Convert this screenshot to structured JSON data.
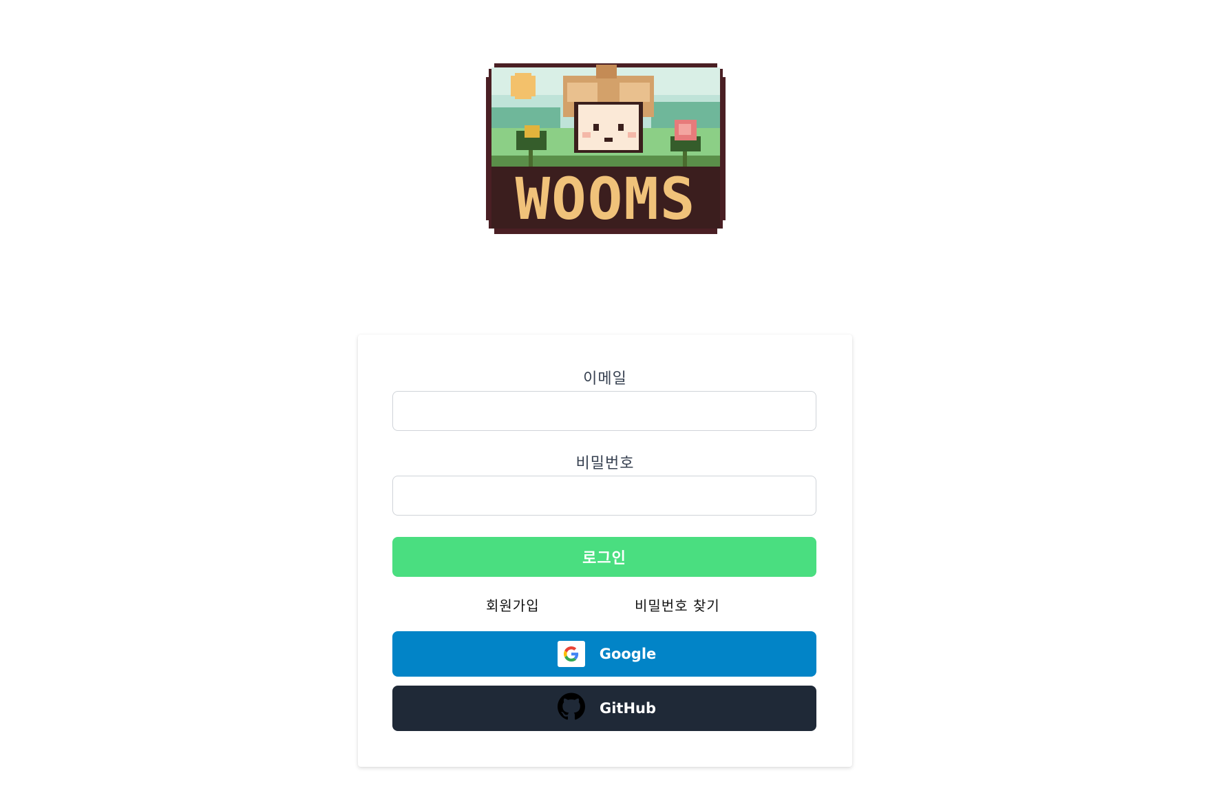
{
  "logo": {
    "text": "WOOMS",
    "alt": "WOOMS pixel art logo"
  },
  "form": {
    "email_label": "이메일",
    "email_value": "",
    "email_placeholder": "",
    "password_label": "비밀번호",
    "password_value": "",
    "password_placeholder": "",
    "login_button": "로그인"
  },
  "links": {
    "signup": "회원가입",
    "find_password": "비밀번호 찾기"
  },
  "social": {
    "google_label": "Google",
    "github_label": "GitHub"
  },
  "colors": {
    "login_button": "#4ade80",
    "google_button": "#0284c7",
    "github_button": "#1f2937"
  }
}
